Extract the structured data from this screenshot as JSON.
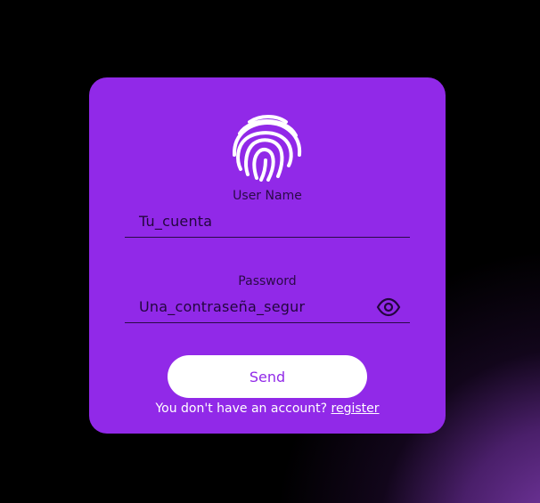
{
  "colors": {
    "card_background": "#9129e8",
    "page_background": "#000000",
    "button_background": "#ffffff",
    "button_text": "#9129e8",
    "field_text": "#23063e"
  },
  "logo": {
    "icon": "fingerprint-icon"
  },
  "username": {
    "label": "User Name",
    "value": "Tu_cuenta"
  },
  "password": {
    "label": "Password",
    "value": "Una_contraseña_segur",
    "toggle_icon": "eye-icon"
  },
  "send_button": {
    "label": "Send"
  },
  "footer": {
    "text": "You don't have an account?",
    "link_label": "register"
  }
}
